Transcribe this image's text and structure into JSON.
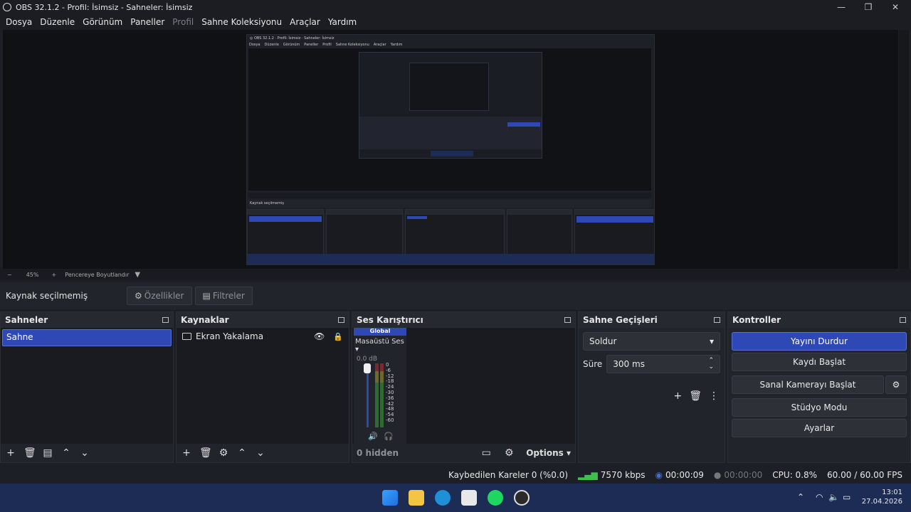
{
  "window": {
    "title": "OBS 32.1.2 - Profil: İsimsiz - Sahneler: İsimsiz",
    "minimize": "—",
    "maximize": "❐",
    "close": "✕"
  },
  "menu": {
    "items": [
      "Dosya",
      "Düzenle",
      "Görünüm",
      "Paneller",
      "Profil",
      "Sahne Koleksiyonu",
      "Araçlar",
      "Yardım"
    ]
  },
  "zoom": {
    "minus": "−",
    "level": "45%",
    "plus": "+",
    "resize_label": "Pencereye Boyutlandır"
  },
  "source_bar": {
    "no_source": "Kaynak seçilmemiş",
    "properties": "Özellikler",
    "filters": "Filtreler"
  },
  "scenes": {
    "title": "Sahneler",
    "items": [
      "Sahne"
    ]
  },
  "sources": {
    "title": "Kaynaklar",
    "items": [
      "Ekran Yakalama"
    ]
  },
  "mixer": {
    "title": "Ses Karıştırıcı",
    "global_label": "Global",
    "channel": "Masaüstü Ses",
    "db": "0.0 dB",
    "scale": [
      "0",
      "-6",
      "-12",
      "-18",
      "-24",
      "-30",
      "-36",
      "-42",
      "-48",
      "-54",
      "-60"
    ],
    "hidden": "0 hidden",
    "options": "Options"
  },
  "transitions": {
    "title": "Sahne Geçişleri",
    "selected": "Soldur",
    "duration_label": "Süre",
    "duration_value": "300 ms"
  },
  "controls": {
    "title": "Kontroller",
    "stop_stream": "Yayını Durdur",
    "start_record": "Kaydı Başlat",
    "start_virtualcam": "Sanal Kamerayı Başlat",
    "studio_mode": "Stüdyo Modu",
    "settings": "Ayarlar"
  },
  "status": {
    "dropped": "Kaybedilen Kareler 0 (%0.0)",
    "bitrate": "7570 kbps",
    "stream_time": "00:00:09",
    "record_time": "00:00:00",
    "cpu": "CPU: 0.8%",
    "fps": "60.00 / 60.00 FPS"
  },
  "taskbar": {
    "time": "13:01",
    "date": "27.04.2026"
  },
  "colors": {
    "accent": "#2e49b6",
    "panel_bg": "#22242b",
    "taskbar": "#1c2c54"
  }
}
